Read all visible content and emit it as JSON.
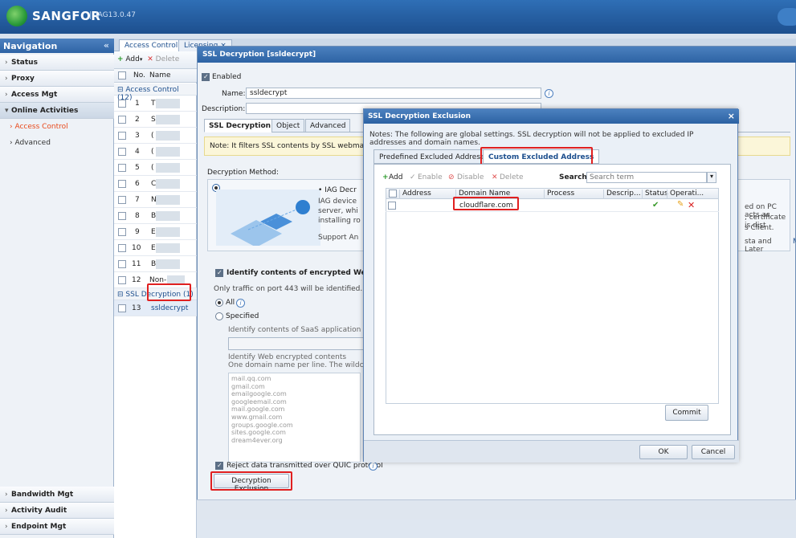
{
  "app": {
    "brand": "SANGFOR",
    "version": "IAG13.0.47"
  },
  "nav": {
    "title": "Navigation",
    "collapse": "«",
    "top_items": [
      "Status",
      "Proxy",
      "Access Mgt",
      "Online Activities"
    ],
    "sub_items": [
      "Access Control",
      "Advanced"
    ],
    "bottom_items": [
      "Bandwidth Mgt",
      "Activity Audit",
      "Endpoint Mgt"
    ]
  },
  "tabs": [
    "Access Control",
    "Licensing"
  ],
  "list": {
    "add": "Add",
    "delete": "Delete",
    "col_no": "No.",
    "col_name": "Name",
    "group1": "Access Control (12)",
    "group2": "SSL Decryption (1)",
    "rows": [
      {
        "no": "1",
        "name": "T"
      },
      {
        "no": "2",
        "name": "S"
      },
      {
        "no": "3",
        "name": "("
      },
      {
        "no": "4",
        "name": "("
      },
      {
        "no": "5",
        "name": "("
      },
      {
        "no": "6",
        "name": "C"
      },
      {
        "no": "7",
        "name": "N"
      },
      {
        "no": "8",
        "name": "B"
      },
      {
        "no": "9",
        "name": "E"
      },
      {
        "no": "10",
        "name": "E"
      },
      {
        "no": "11",
        "name": "B"
      },
      {
        "no": "12",
        "name": "Non-"
      }
    ],
    "row13": {
      "no": "13",
      "name": "ssldecrypt"
    }
  },
  "editor": {
    "title": "SSL Decryption [ssldecrypt]",
    "enabled": "Enabled",
    "name_label": "Name:",
    "name_value": "ssldecrypt",
    "desc_label": "Description:",
    "tabs": [
      "SSL Decryption",
      "Object",
      "Advanced"
    ],
    "note": "Note: It filters SSL contents by SSL webmail, w",
    "method_label": "Decryption Method:",
    "iag_title": "• IAG Decr",
    "iag_lines": [
      "IAG device",
      "server, whi",
      "installing ro"
    ],
    "support": "Support An",
    "right_1": "ed on PC acts as",
    "right_2": ", certificate is dist",
    "right_3": "s Client.",
    "right_4": "sta and Later",
    "right_5": "M",
    "identify_label": "Identify contents of encrypted Web ap",
    "port_note": "Only traffic on port 443 will be identified.",
    "all": "All",
    "specified": "Specified",
    "saas_label": "Identify contents of SaaS application or w",
    "web_label": "Identify Web encrypted contents",
    "web_hint": "One domain name per line. The wildcard c",
    "domains": [
      "mail.qq.com",
      "gmail.com",
      "emailgoogle.com",
      "googleemail.com",
      "mail.google.com",
      "www.gmail.com",
      "groups.google.com",
      "sites.google.com",
      "dream4ever.org"
    ],
    "quic": "Reject data transmitted over QUIC protocol",
    "exclusion_button": "Decryption Exclusion"
  },
  "dialog": {
    "title": "SSL Decryption Exclusion",
    "close": "×",
    "notes": "Notes: The following are global settings. SSL decryption will not be applied to excluded IP addresses and domain names.",
    "tab_predefined": "Predefined Excluded Address",
    "tab_custom": "Custom Excluded Address",
    "toolbar": {
      "add": "Add",
      "enable": "Enable",
      "disable": "Disable",
      "delete": "Delete",
      "search_label": "Search:",
      "search_placeholder": "Search term"
    },
    "columns": [
      "Address",
      "Domain Name",
      "Process",
      "Descrip...",
      "Status",
      "Operati..."
    ],
    "rows": [
      {
        "address": "",
        "domain": "cloudflare.com",
        "process": "",
        "description": "",
        "status": "✔"
      }
    ],
    "commit": "Commit",
    "ok": "OK",
    "cancel": "Cancel"
  },
  "colors": {
    "header_blue": "#2d63a4",
    "highlight_red": "#e02020",
    "active_nav": "#e84a1c",
    "status_green": "#3a9a2a"
  }
}
